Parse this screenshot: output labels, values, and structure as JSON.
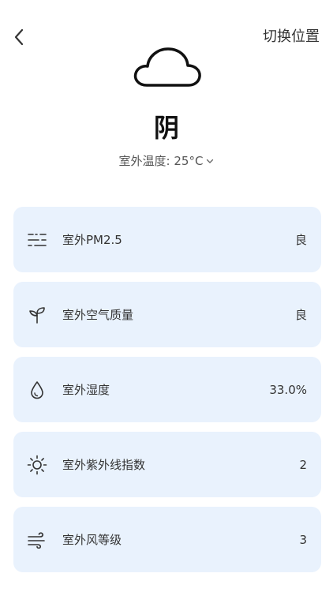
{
  "header": {
    "switch_location_label": "切换位置"
  },
  "weather": {
    "icon": "cloud-icon",
    "condition": "阴",
    "outdoor_temp_label": "室外温度: 25°C"
  },
  "cards": [
    {
      "icon": "sliders-icon",
      "label": "室外PM2.5",
      "value": "良"
    },
    {
      "icon": "sprout-icon",
      "label": "室外空气质量",
      "value": "良"
    },
    {
      "icon": "droplet-icon",
      "label": "室外湿度",
      "value": "33.0%"
    },
    {
      "icon": "sun-icon",
      "label": "室外紫外线指数",
      "value": "2"
    },
    {
      "icon": "wind-icon",
      "label": "室外风等级",
      "value": "3"
    }
  ],
  "colors": {
    "card_background": "#e9f2fd",
    "text_primary": "#333333"
  }
}
